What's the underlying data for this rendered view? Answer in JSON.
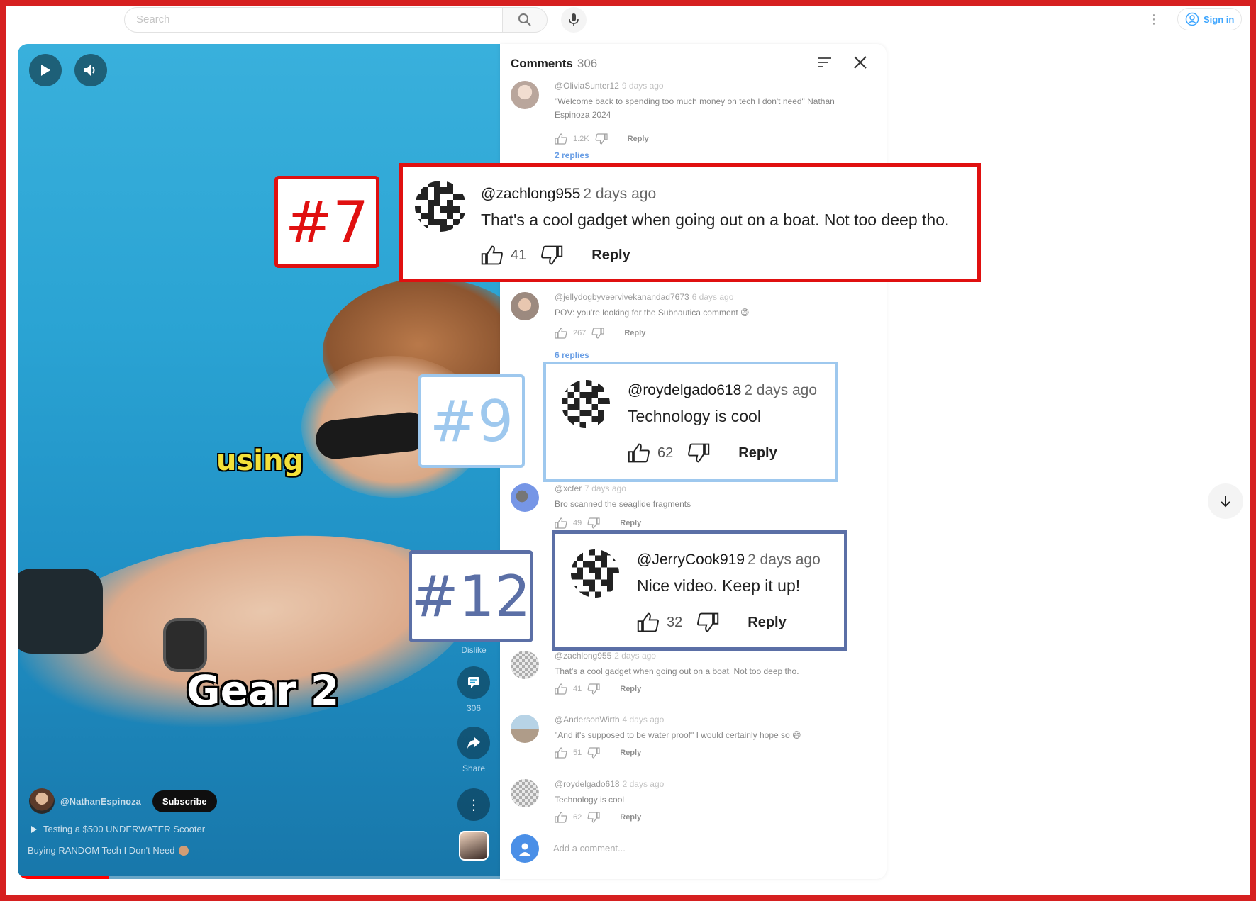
{
  "topbar": {
    "search_placeholder": "Search",
    "sign_in_label": "Sign in"
  },
  "video": {
    "caption_1": "using",
    "caption_2": "Gear 2",
    "channel_name": "@NathanEspinoza",
    "subscribe_label": "Subscribe",
    "playlist_line": "Testing a $500 UNDERWATER Scooter",
    "title_line": "Buying RANDOM Tech I Don't Need",
    "rail": {
      "dislike_label": "Dislike",
      "comments_count": "306",
      "share_label": "Share"
    },
    "progress_fraction": 0.19
  },
  "comments_panel": {
    "title": "Comments",
    "count": "306",
    "add_comment_placeholder": "Add a comment...",
    "comments": [
      {
        "user": "@OliviaSunter12",
        "time": "9 days ago",
        "text": "\"Welcome back to spending too much money on tech I don't need\" Nathan Espinoza 2024",
        "likes": "1.2K",
        "reply": "Reply",
        "replies": "2 replies"
      },
      {
        "user": "@jellydogbyveervivekanandad7673",
        "time": "6 days ago",
        "text": "POV: you're looking for the Subnautica comment 😄",
        "likes": "267",
        "reply": "Reply",
        "replies": "6 replies"
      },
      {
        "user": "@xcfer",
        "time": "7 days ago",
        "text": "Bro scanned the seaglide fragments",
        "likes": "49",
        "reply": "Reply"
      },
      {
        "user": "@zachlong955",
        "time": "2 days ago",
        "text": "That's a cool gadget when going out on a boat. Not too deep tho.",
        "likes": "41",
        "reply": "Reply"
      },
      {
        "user": "@AndersonWirth",
        "time": "4 days ago",
        "text": "\"And it's supposed to be water proof\" I would certainly hope so 😄",
        "likes": "51",
        "reply": "Reply"
      },
      {
        "user": "@roydelgado618",
        "time": "2 days ago",
        "text": "Technology is cool",
        "likes": "62",
        "reply": "Reply"
      }
    ]
  },
  "highlights": [
    {
      "badge": "#7",
      "user": "@zachlong955",
      "time": "2 days ago",
      "text": "That's a cool gadget when going out on a boat. Not too deep tho.",
      "likes": "41",
      "reply": "Reply",
      "color": "#e01010"
    },
    {
      "badge": "#9",
      "user": "@roydelgado618",
      "time": "2 days ago",
      "text": "Technology is cool",
      "likes": "62",
      "reply": "Reply",
      "color": "#9ec8ee"
    },
    {
      "badge": "#12",
      "user": "@JerryCook919",
      "time": "2 days ago",
      "text": "Nice video. Keep it up!",
      "likes": "32",
      "reply": "Reply",
      "color": "#5b6fa6"
    }
  ],
  "colors": {
    "frame": "#d62020",
    "link": "#065fd4",
    "accent": "#3ea6ff"
  }
}
